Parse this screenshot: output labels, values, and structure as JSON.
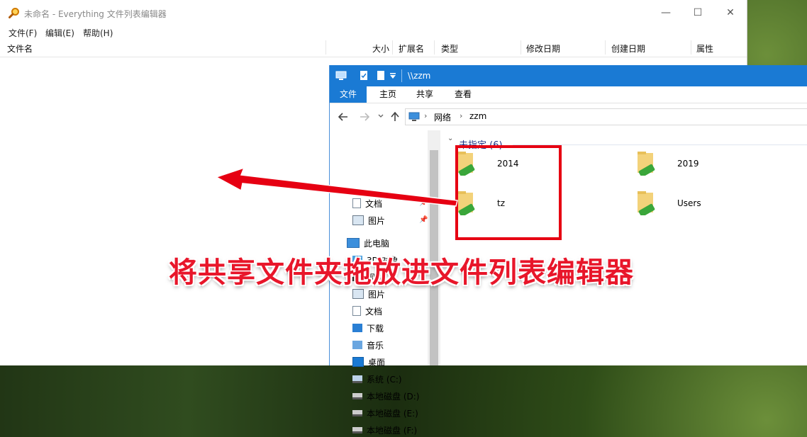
{
  "everything": {
    "title": "未命名 - Everything 文件列表编辑器",
    "menu": [
      "文件(F)",
      "编辑(E)",
      "帮助(H)"
    ],
    "columns": [
      "文件名",
      "大小",
      "扩展名",
      "类型",
      "修改日期",
      "创建日期",
      "属性"
    ],
    "window_controls": {
      "minimize": "—",
      "maximize": "☐",
      "close": "✕"
    }
  },
  "explorer": {
    "title": "\\\\zzm",
    "ribbon_tabs": [
      "文件",
      "主页",
      "共享",
      "查看"
    ],
    "breadcrumb": [
      "网络",
      "zzm"
    ],
    "group_header": "未指定 (6)",
    "nav": [
      {
        "label": "文档",
        "icon": "document-icon",
        "pinned": true
      },
      {
        "label": "图片",
        "icon": "picture-icon",
        "pinned": true
      },
      {
        "label": "此电脑",
        "icon": "computer-icon",
        "pinned": false
      },
      {
        "label": "3D 对象",
        "icon": "3d-icon",
        "pinned": false
      },
      {
        "label": "视频",
        "icon": "video-icon",
        "pinned": false
      },
      {
        "label": "图片",
        "icon": "picture-icon",
        "pinned": false
      },
      {
        "label": "文档",
        "icon": "document-icon",
        "pinned": false
      },
      {
        "label": "下载",
        "icon": "download-icon",
        "pinned": false
      },
      {
        "label": "音乐",
        "icon": "music-icon",
        "pinned": false
      },
      {
        "label": "桌面",
        "icon": "desktop-icon",
        "pinned": false
      },
      {
        "label": "系统 (C:)",
        "icon": "drive-icon",
        "pinned": false
      },
      {
        "label": "本地磁盘 (D:)",
        "icon": "drive-icon",
        "pinned": false
      },
      {
        "label": "本地磁盘 (E:)",
        "icon": "drive-icon",
        "pinned": false
      },
      {
        "label": "本地磁盘 (F:)",
        "icon": "drive-icon",
        "pinned": false
      }
    ],
    "folders": [
      "2014",
      "2019",
      "tz",
      "Users"
    ]
  },
  "overlay": {
    "caption": "将共享文件夹拖放进文件列表编辑器"
  },
  "colors": {
    "accent": "#1a7ad4",
    "highlight": "#e60012",
    "folder": "#f3d27a",
    "share": "#3aa63a"
  }
}
